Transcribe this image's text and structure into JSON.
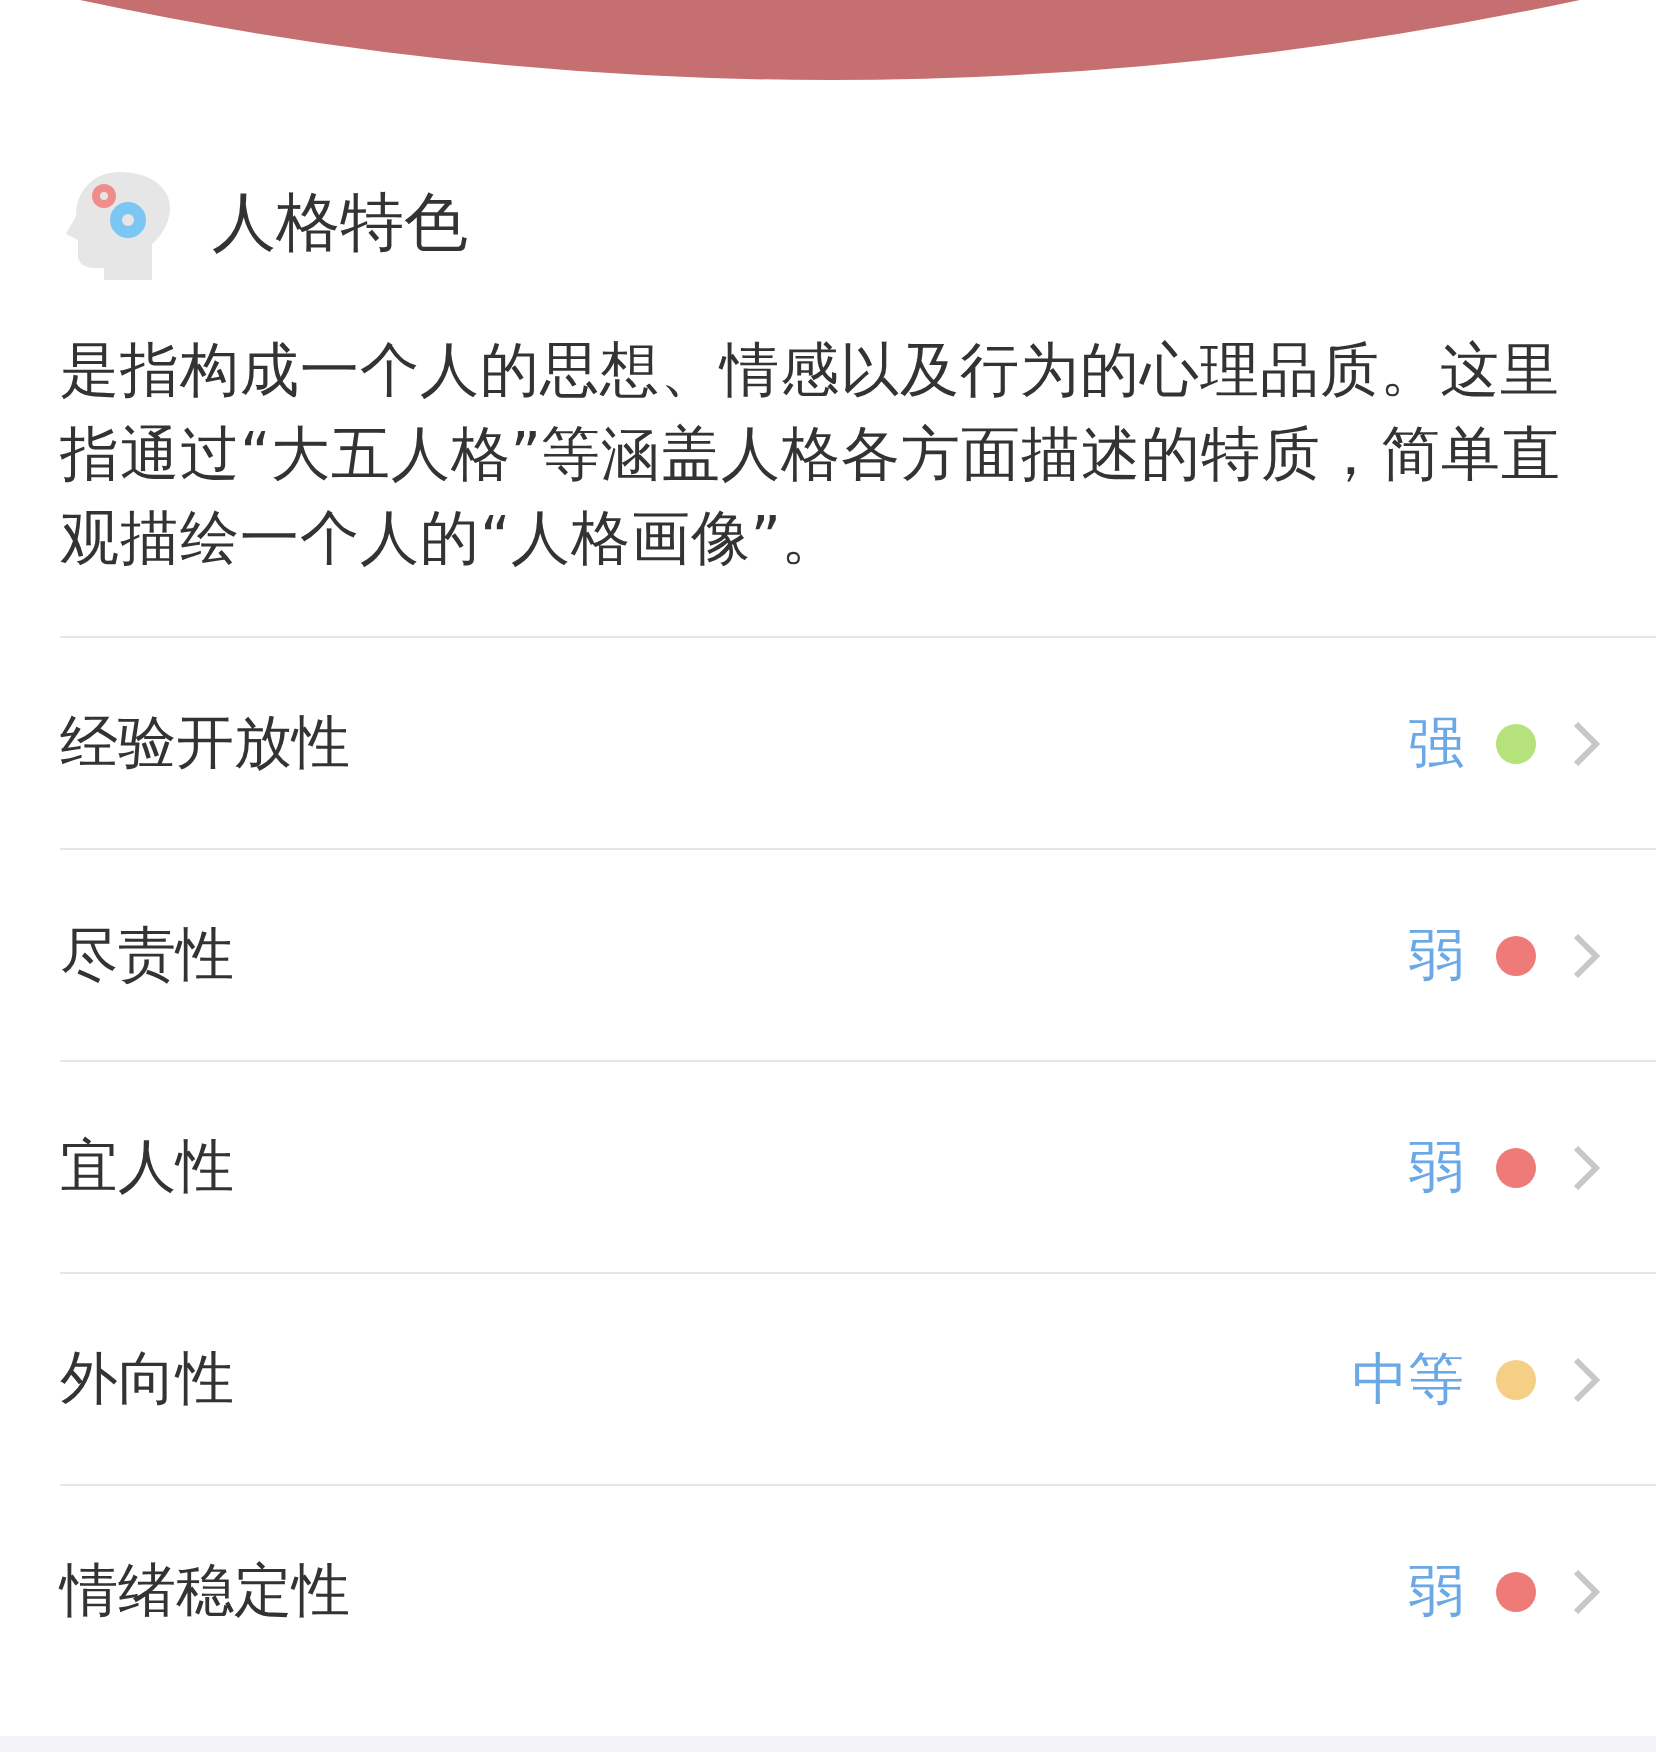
{
  "section": {
    "title": "人格特色",
    "description": "是指构成一个人的思想、情感以及行为的心理品质。这里指通过“大五人格”等涵盖人格各方面描述的特质，简单直观描绘一个人的“人格画像”。"
  },
  "traits": [
    {
      "name": "经验开放性",
      "level_text": "强",
      "color": "#b5e27a"
    },
    {
      "name": "尽责性",
      "level_text": "弱",
      "color": "#ee7b78"
    },
    {
      "name": "宜人性",
      "level_text": "弱",
      "color": "#ee7b78"
    },
    {
      "name": "外向性",
      "level_text": "中等",
      "color": "#f5cf86"
    },
    {
      "name": "情绪稳定性",
      "level_text": "弱",
      "color": "#ee7b78"
    }
  ]
}
